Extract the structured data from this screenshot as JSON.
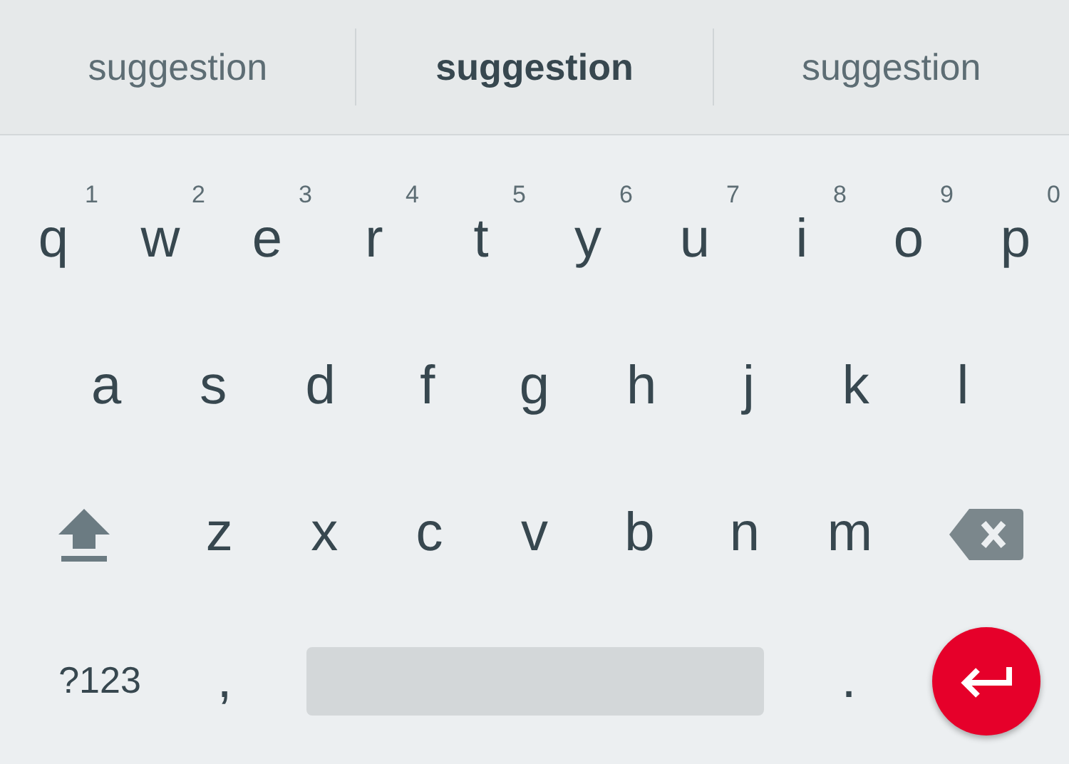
{
  "suggestions": [
    {
      "text": "suggestion",
      "primary": false
    },
    {
      "text": "suggestion",
      "primary": true
    },
    {
      "text": "suggestion",
      "primary": false
    }
  ],
  "rows": [
    {
      "keys": [
        {
          "kind": "letter",
          "label": "q",
          "hint": "1"
        },
        {
          "kind": "letter",
          "label": "w",
          "hint": "2"
        },
        {
          "kind": "letter",
          "label": "e",
          "hint": "3"
        },
        {
          "kind": "letter",
          "label": "r",
          "hint": "4"
        },
        {
          "kind": "letter",
          "label": "t",
          "hint": "5"
        },
        {
          "kind": "letter",
          "label": "y",
          "hint": "6"
        },
        {
          "kind": "letter",
          "label": "u",
          "hint": "7"
        },
        {
          "kind": "letter",
          "label": "i",
          "hint": "8"
        },
        {
          "kind": "letter",
          "label": "o",
          "hint": "9"
        },
        {
          "kind": "letter",
          "label": "p",
          "hint": "0"
        }
      ]
    },
    {
      "keys": [
        {
          "kind": "letter",
          "label": "a"
        },
        {
          "kind": "letter",
          "label": "s"
        },
        {
          "kind": "letter",
          "label": "d"
        },
        {
          "kind": "letter",
          "label": "f"
        },
        {
          "kind": "letter",
          "label": "g"
        },
        {
          "kind": "letter",
          "label": "h"
        },
        {
          "kind": "letter",
          "label": "j"
        },
        {
          "kind": "letter",
          "label": "k"
        },
        {
          "kind": "letter",
          "label": "l"
        }
      ]
    },
    {
      "keys": [
        {
          "kind": "shift"
        },
        {
          "kind": "letter",
          "label": "z"
        },
        {
          "kind": "letter",
          "label": "x"
        },
        {
          "kind": "letter",
          "label": "c"
        },
        {
          "kind": "letter",
          "label": "v"
        },
        {
          "kind": "letter",
          "label": "b"
        },
        {
          "kind": "letter",
          "label": "n"
        },
        {
          "kind": "letter",
          "label": "m"
        },
        {
          "kind": "backspace"
        }
      ]
    },
    {
      "keys": [
        {
          "kind": "symbols",
          "label": "?123"
        },
        {
          "kind": "comma",
          "label": ","
        },
        {
          "kind": "space"
        },
        {
          "kind": "period",
          "label": "."
        },
        {
          "kind": "enter"
        }
      ]
    }
  ]
}
